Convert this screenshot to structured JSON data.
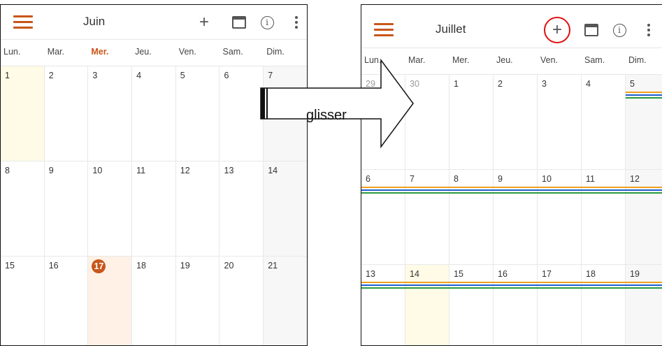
{
  "left_panel": {
    "month": "Juin",
    "weekdays": [
      "Lun.",
      "Mar.",
      "Mer.",
      "Jeu.",
      "Ven.",
      "Sam.",
      "Dim."
    ],
    "today_column": 2,
    "weeks": [
      [
        "1",
        "2",
        "3",
        "4",
        "5",
        "6",
        "7"
      ],
      [
        "8",
        "9",
        "10",
        "11",
        "12",
        "13",
        "14"
      ],
      [
        "15",
        "16",
        "17",
        "18",
        "19",
        "20",
        "21"
      ]
    ],
    "today": "17"
  },
  "right_panel": {
    "month": "Juillet",
    "weekdays": [
      "Lun.",
      "Mar.",
      "Mer.",
      "Jeu.",
      "Ven.",
      "Sam.",
      "Dim."
    ],
    "weeks": [
      [
        "29",
        "30",
        "1",
        "2",
        "3",
        "4",
        "5"
      ],
      [
        "6",
        "7",
        "8",
        "9",
        "10",
        "11",
        "12"
      ],
      [
        "13",
        "14",
        "15",
        "16",
        "17",
        "18",
        "19"
      ]
    ]
  },
  "arrow": {
    "label": "glisser"
  },
  "colors": {
    "accent": "#c8561a",
    "annotation_ring": "#e01010",
    "event_orange": "#f0a020",
    "event_blue": "#2060d0",
    "event_green": "#2a9a40"
  },
  "icons": [
    "menu-icon",
    "add-icon",
    "calendar-icon",
    "info-icon",
    "more-vertical-icon"
  ]
}
